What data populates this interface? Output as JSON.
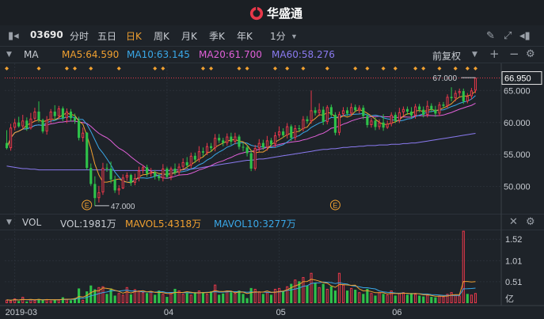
{
  "app": {
    "logo_text": "华盛通"
  },
  "toolbar": {
    "code": "03690",
    "periods": [
      "分时",
      "五日",
      "日K",
      "周K",
      "月K",
      "季K",
      "年K",
      "1分"
    ],
    "active_period": "日K"
  },
  "ma": {
    "label": "MA",
    "items": [
      {
        "text": "MA5:64.590",
        "color": "#f0a030"
      },
      {
        "text": "MA10:63.145",
        "color": "#3aa8e8"
      },
      {
        "text": "MA20:61.700",
        "color": "#e060d8"
      },
      {
        "text": "MA60:58.276",
        "color": "#8a7af0"
      }
    ],
    "adjust": "前复权"
  },
  "vol": {
    "label": "VOL",
    "items": [
      {
        "text": "VOL:1981万",
        "color": "#c8ccd2"
      },
      {
        "text": "MAVOL5:4318万",
        "color": "#f0a030"
      },
      {
        "text": "MAVOL10:3277万",
        "color": "#3aa8e8"
      }
    ]
  },
  "chart_data": {
    "type": "candlestick",
    "price_axis": {
      "ticks": [
        65.0,
        60.0,
        55.0,
        50.0
      ],
      "range": [
        46,
        68.5
      ],
      "last_price": "66.950"
    },
    "volume_axis": {
      "ticks": [
        "1.52",
        "1.01",
        "0.51"
      ],
      "unit": "亿",
      "range": [
        0,
        1.75
      ]
    },
    "x_labels": [
      {
        "label": "2019-03",
        "index": 2
      },
      {
        "label": "04",
        "index": 40
      },
      {
        "label": "05",
        "index": 68
      },
      {
        "label": "06",
        "index": 97
      }
    ],
    "annotations": {
      "high": "67.000",
      "low": "47.000",
      "event_marker": "E"
    },
    "colors": {
      "up": "#e8384a",
      "down": "#2ec24a",
      "ma5": "#f0a030",
      "ma10": "#3aa8e8",
      "ma20": "#e060d8",
      "ma60": "#8a7af0",
      "event": "#f0a030"
    },
    "candles": [
      [
        56.8,
        56.0,
        58.8,
        55.8
      ],
      [
        56.0,
        59.2,
        59.8,
        55.6
      ],
      [
        59.2,
        60.0,
        60.6,
        58.8
      ],
      [
        60.0,
        59.4,
        60.9,
        59.2
      ],
      [
        59.4,
        60.3,
        61.2,
        59.0
      ],
      [
        60.3,
        59.1,
        60.8,
        58.7
      ],
      [
        59.1,
        60.6,
        61.5,
        58.9
      ],
      [
        60.6,
        61.7,
        62.3,
        60.1
      ],
      [
        61.7,
        60.4,
        63.3,
        60.0
      ],
      [
        60.4,
        58.6,
        60.6,
        58.3
      ],
      [
        58.6,
        60.4,
        61.0,
        58.1
      ],
      [
        60.4,
        61.7,
        62.1,
        59.9
      ],
      [
        61.7,
        61.0,
        62.7,
        60.3
      ],
      [
        61.0,
        62.2,
        62.6,
        60.5
      ],
      [
        62.2,
        60.7,
        62.5,
        60.2
      ],
      [
        60.7,
        61.7,
        62.2,
        59.9
      ],
      [
        61.7,
        60.7,
        62.1,
        60.2
      ],
      [
        60.7,
        60.3,
        61.4,
        59.8
      ],
      [
        60.3,
        57.6,
        60.9,
        57.2
      ],
      [
        57.6,
        58.4,
        59.2,
        57.0
      ],
      [
        58.4,
        52.9,
        58.5,
        52.6
      ],
      [
        52.9,
        50.4,
        53.6,
        50.1
      ],
      [
        50.4,
        48.2,
        51.6,
        47.0
      ],
      [
        48.2,
        49.1,
        50.1,
        47.5
      ],
      [
        49.1,
        52.9,
        53.7,
        48.7
      ],
      [
        52.9,
        52.8,
        53.6,
        52.3
      ],
      [
        52.8,
        51.1,
        53.9,
        50.5
      ],
      [
        51.1,
        49.4,
        51.7,
        49.0
      ],
      [
        49.4,
        49.7,
        50.2,
        48.7
      ],
      [
        49.7,
        51.4,
        51.9,
        49.6
      ],
      [
        51.4,
        51.8,
        52.2,
        50.9
      ],
      [
        51.8,
        50.6,
        52.0,
        50.1
      ],
      [
        50.6,
        51.3,
        52.0,
        50.2
      ],
      [
        51.3,
        52.5,
        53.1,
        50.8
      ],
      [
        52.5,
        53.0,
        53.3,
        52.0
      ],
      [
        53.0,
        52.0,
        53.4,
        51.5
      ],
      [
        52.0,
        52.2,
        52.9,
        51.5
      ],
      [
        52.2,
        51.6,
        52.6,
        51.1
      ],
      [
        51.6,
        51.3,
        52.0,
        50.9
      ],
      [
        51.3,
        52.8,
        53.5,
        50.8
      ],
      [
        52.8,
        51.5,
        53.1,
        51.2
      ],
      [
        51.5,
        52.8,
        53.1,
        51.0
      ],
      [
        52.8,
        52.2,
        53.6,
        51.8
      ],
      [
        52.2,
        53.1,
        53.6,
        51.7
      ],
      [
        53.1,
        53.8,
        54.4,
        52.8
      ],
      [
        53.8,
        53.3,
        54.6,
        52.8
      ],
      [
        53.3,
        54.8,
        55.3,
        52.8
      ],
      [
        54.8,
        54.2,
        55.3,
        53.7
      ],
      [
        54.2,
        55.5,
        56.3,
        53.8
      ],
      [
        55.5,
        55.3,
        56.1,
        54.7
      ],
      [
        55.3,
        56.3,
        56.8,
        54.9
      ],
      [
        56.3,
        56.0,
        56.8,
        55.4
      ],
      [
        56.0,
        57.6,
        58.2,
        55.5
      ],
      [
        57.6,
        57.2,
        58.2,
        56.8
      ],
      [
        57.2,
        56.8,
        57.6,
        56.3
      ],
      [
        56.8,
        57.8,
        58.3,
        56.4
      ],
      [
        57.8,
        57.0,
        58.4,
        56.5
      ],
      [
        57.0,
        57.8,
        58.4,
        56.6
      ],
      [
        57.8,
        56.2,
        58.1,
        55.8
      ],
      [
        56.2,
        56.1,
        56.8,
        55.5
      ],
      [
        56.1,
        55.2,
        56.5,
        54.7
      ],
      [
        55.2,
        52.8,
        55.7,
        52.4
      ],
      [
        52.8,
        56.0,
        56.5,
        52.5
      ],
      [
        56.0,
        56.8,
        57.4,
        55.4
      ],
      [
        56.8,
        56.1,
        57.3,
        55.7
      ],
      [
        56.1,
        57.2,
        57.9,
        55.6
      ],
      [
        57.2,
        56.6,
        57.6,
        56.2
      ],
      [
        56.6,
        58.0,
        58.5,
        56.1
      ],
      [
        58.0,
        58.6,
        59.4,
        57.6
      ],
      [
        58.6,
        58.0,
        59.1,
        57.6
      ],
      [
        58.0,
        59.4,
        59.9,
        57.5
      ],
      [
        59.4,
        57.6,
        59.7,
        57.1
      ],
      [
        57.6,
        59.1,
        59.6,
        57.2
      ],
      [
        59.1,
        59.0,
        59.6,
        58.5
      ],
      [
        59.0,
        60.5,
        61.0,
        58.6
      ],
      [
        60.5,
        60.2,
        61.0,
        59.8
      ],
      [
        60.2,
        61.9,
        65.0,
        59.8
      ],
      [
        61.9,
        61.5,
        62.4,
        61.1
      ],
      [
        61.5,
        62.0,
        63.0,
        61.0
      ],
      [
        62.0,
        60.1,
        62.5,
        59.6
      ],
      [
        60.1,
        62.4,
        62.7,
        59.7
      ],
      [
        62.4,
        61.2,
        62.8,
        60.9
      ],
      [
        61.2,
        58.4,
        61.6,
        58.0
      ],
      [
        58.4,
        61.3,
        61.7,
        58.0
      ],
      [
        61.3,
        61.9,
        62.4,
        60.9
      ],
      [
        61.9,
        61.4,
        62.4,
        61.0
      ],
      [
        61.4,
        62.4,
        63.0,
        61.0
      ],
      [
        62.4,
        61.9,
        62.8,
        61.6
      ],
      [
        61.9,
        62.3,
        62.7,
        61.4
      ],
      [
        62.3,
        61.0,
        62.7,
        60.5
      ],
      [
        61.0,
        59.6,
        61.4,
        59.2
      ],
      [
        59.6,
        60.3,
        60.7,
        59.2
      ],
      [
        60.3,
        59.3,
        60.8,
        58.8
      ],
      [
        59.3,
        60.0,
        60.5,
        58.9
      ],
      [
        60.0,
        59.2,
        61.3,
        58.7
      ],
      [
        59.2,
        59.8,
        60.3,
        59.0
      ],
      [
        59.8,
        61.2,
        61.6,
        59.4
      ],
      [
        61.2,
        60.3,
        61.6,
        59.9
      ],
      [
        60.3,
        61.6,
        62.3,
        59.9
      ],
      [
        61.6,
        62.1,
        62.5,
        61.0
      ],
      [
        62.1,
        61.7,
        62.5,
        61.2
      ],
      [
        61.7,
        61.1,
        62.4,
        60.7
      ],
      [
        61.1,
        62.5,
        62.9,
        60.6
      ],
      [
        62.5,
        62.0,
        62.9,
        61.6
      ],
      [
        62.0,
        61.2,
        62.5,
        60.8
      ],
      [
        61.2,
        62.6,
        63.4,
        60.8
      ],
      [
        62.6,
        62.0,
        63.0,
        61.6
      ],
      [
        62.0,
        61.4,
        62.6,
        60.9
      ],
      [
        61.4,
        62.8,
        63.2,
        61.0
      ],
      [
        62.8,
        62.6,
        63.2,
        62.2
      ],
      [
        62.6,
        64.0,
        64.4,
        62.2
      ],
      [
        64.0,
        63.8,
        65.5,
        63.3
      ],
      [
        63.8,
        64.6,
        65.0,
        63.3
      ],
      [
        64.6,
        64.9,
        65.3,
        64.1
      ],
      [
        64.9,
        63.3,
        65.3,
        62.9
      ],
      [
        63.3,
        64.1,
        64.6,
        63.0
      ],
      [
        64.1,
        65.0,
        65.4,
        63.6
      ],
      [
        65.0,
        67.0,
        67.0,
        64.6
      ]
    ],
    "volume": [
      {
        "v": 0.08,
        "up": true
      },
      {
        "v": 0.06,
        "up": true
      },
      {
        "v": 0.11,
        "up": true
      },
      {
        "v": 0.05,
        "up": false
      },
      {
        "v": 0.15,
        "up": true
      },
      {
        "v": 0.04,
        "up": false
      },
      {
        "v": 0.09,
        "up": true
      },
      {
        "v": 0.07,
        "up": true
      },
      {
        "v": 0.1,
        "up": false
      },
      {
        "v": 0.08,
        "up": false
      },
      {
        "v": 0.09,
        "up": true
      },
      {
        "v": 0.06,
        "up": true
      },
      {
        "v": 0.08,
        "up": false
      },
      {
        "v": 0.09,
        "up": true
      },
      {
        "v": 0.14,
        "up": false
      },
      {
        "v": 0.1,
        "up": true
      },
      {
        "v": 0.07,
        "up": false
      },
      {
        "v": 0.12,
        "up": false
      },
      {
        "v": 0.35,
        "up": false
      },
      {
        "v": 0.08,
        "up": true
      },
      {
        "v": 0.28,
        "up": false
      },
      {
        "v": 0.42,
        "up": false
      },
      {
        "v": 0.33,
        "up": false
      },
      {
        "v": 0.38,
        "up": true
      },
      {
        "v": 0.4,
        "up": true
      },
      {
        "v": 0.22,
        "up": false
      },
      {
        "v": 0.35,
        "up": false
      },
      {
        "v": 0.18,
        "up": false
      },
      {
        "v": 0.24,
        "up": true
      },
      {
        "v": 0.2,
        "up": true
      },
      {
        "v": 0.38,
        "up": true
      },
      {
        "v": 0.21,
        "up": false
      },
      {
        "v": 0.33,
        "up": true
      },
      {
        "v": 0.3,
        "up": true
      },
      {
        "v": 0.26,
        "up": true
      },
      {
        "v": 0.24,
        "up": false
      },
      {
        "v": 0.28,
        "up": true
      },
      {
        "v": 0.2,
        "up": false
      },
      {
        "v": 0.3,
        "up": false
      },
      {
        "v": 0.22,
        "up": true
      },
      {
        "v": 0.15,
        "up": false
      },
      {
        "v": 0.26,
        "up": true
      },
      {
        "v": 0.34,
        "up": false
      },
      {
        "v": 0.3,
        "up": true
      },
      {
        "v": 0.22,
        "up": true
      },
      {
        "v": 0.24,
        "up": false
      },
      {
        "v": 0.2,
        "up": true
      },
      {
        "v": 0.26,
        "up": false
      },
      {
        "v": 0.3,
        "up": true
      },
      {
        "v": 0.26,
        "up": false
      },
      {
        "v": 0.22,
        "up": true
      },
      {
        "v": 0.28,
        "up": false
      },
      {
        "v": 0.44,
        "up": true
      },
      {
        "v": 0.2,
        "up": false
      },
      {
        "v": 0.23,
        "up": false
      },
      {
        "v": 0.3,
        "up": true
      },
      {
        "v": 0.26,
        "up": false
      },
      {
        "v": 0.24,
        "up": true
      },
      {
        "v": 0.3,
        "up": false
      },
      {
        "v": 0.22,
        "up": false
      },
      {
        "v": 0.12,
        "up": false
      },
      {
        "v": 0.36,
        "up": false
      },
      {
        "v": 0.34,
        "up": true
      },
      {
        "v": 0.28,
        "up": true
      },
      {
        "v": 0.22,
        "up": false
      },
      {
        "v": 0.26,
        "up": true
      },
      {
        "v": 0.2,
        "up": false
      },
      {
        "v": 0.34,
        "up": true
      },
      {
        "v": 0.36,
        "up": true
      },
      {
        "v": 0.28,
        "up": false
      },
      {
        "v": 0.4,
        "up": true
      },
      {
        "v": 0.46,
        "up": false
      },
      {
        "v": 0.56,
        "up": true
      },
      {
        "v": 0.52,
        "up": false
      },
      {
        "v": 0.62,
        "up": true
      },
      {
        "v": 0.42,
        "up": false
      },
      {
        "v": 0.72,
        "up": true
      },
      {
        "v": 0.48,
        "up": false
      },
      {
        "v": 0.38,
        "up": true
      },
      {
        "v": 0.46,
        "up": false
      },
      {
        "v": 0.34,
        "up": true
      },
      {
        "v": 0.4,
        "up": false
      },
      {
        "v": 0.3,
        "up": false
      },
      {
        "v": 0.72,
        "up": true
      },
      {
        "v": 0.44,
        "up": true
      },
      {
        "v": 0.3,
        "up": false
      },
      {
        "v": 0.36,
        "up": true
      },
      {
        "v": 0.32,
        "up": false
      },
      {
        "v": 0.26,
        "up": true
      },
      {
        "v": 0.22,
        "up": false
      },
      {
        "v": 0.34,
        "up": false
      },
      {
        "v": 0.24,
        "up": true
      },
      {
        "v": 0.18,
        "up": false
      },
      {
        "v": 0.26,
        "up": true
      },
      {
        "v": 0.22,
        "up": false
      },
      {
        "v": 0.2,
        "up": true
      },
      {
        "v": 0.3,
        "up": true
      },
      {
        "v": 0.18,
        "up": false
      },
      {
        "v": 0.24,
        "up": true
      },
      {
        "v": 0.26,
        "up": true
      },
      {
        "v": 0.2,
        "up": false
      },
      {
        "v": 0.24,
        "up": false
      },
      {
        "v": 0.22,
        "up": true
      },
      {
        "v": 0.18,
        "up": false
      },
      {
        "v": 0.16,
        "up": false
      },
      {
        "v": 0.2,
        "up": true
      },
      {
        "v": 0.15,
        "up": false
      },
      {
        "v": 0.14,
        "up": false
      },
      {
        "v": 0.18,
        "up": true
      },
      {
        "v": 0.16,
        "up": true
      },
      {
        "v": 0.22,
        "up": true
      },
      {
        "v": 0.26,
        "up": true
      },
      {
        "v": 0.2,
        "up": true
      },
      {
        "v": 0.18,
        "up": true
      },
      {
        "v": 1.72,
        "up": true
      },
      {
        "v": 0.22,
        "up": false
      },
      {
        "v": 0.2,
        "up": true
      },
      {
        "v": 0.24,
        "up": true
      }
    ],
    "ma60": [
      53.2,
      53.1,
      53.0,
      52.9,
      52.8,
      52.8,
      52.7,
      52.7,
      52.6,
      52.6,
      52.6,
      52.6,
      52.6,
      52.6,
      52.6,
      52.6,
      52.6,
      52.6,
      52.6,
      52.6,
      52.6,
      52.6,
      52.6,
      52.6,
      52.6,
      52.6,
      52.6,
      52.5,
      52.5,
      52.5,
      52.5,
      52.5,
      52.5,
      52.5,
      52.5,
      52.5,
      52.5,
      52.5,
      52.5,
      52.5,
      52.5,
      52.5,
      52.6,
      52.6,
      52.6,
      52.7,
      52.7,
      52.8,
      52.9,
      53.0,
      53.1,
      53.2,
      53.3,
      53.4,
      53.5,
      53.6,
      53.7,
      53.8,
      53.9,
      54.0,
      54.1,
      54.1,
      54.2,
      54.3,
      54.3,
      54.4,
      54.5,
      54.6,
      54.7,
      54.8,
      54.9,
      55.0,
      55.1,
      55.2,
      55.3,
      55.4,
      55.5,
      55.6,
      55.7,
      55.8,
      55.8,
      55.9,
      55.9,
      56.0,
      56.1,
      56.1,
      56.2,
      56.2,
      56.3,
      56.3,
      56.4,
      56.4,
      56.4,
      56.5,
      56.5,
      56.5,
      56.6,
      56.6,
      56.6,
      56.7,
      56.7,
      56.8,
      56.8,
      56.9,
      57.0,
      57.1,
      57.2,
      57.3,
      57.4,
      57.5,
      57.6,
      57.7,
      57.8,
      57.9,
      58.0,
      58.1,
      58.2,
      58.3
    ]
  }
}
